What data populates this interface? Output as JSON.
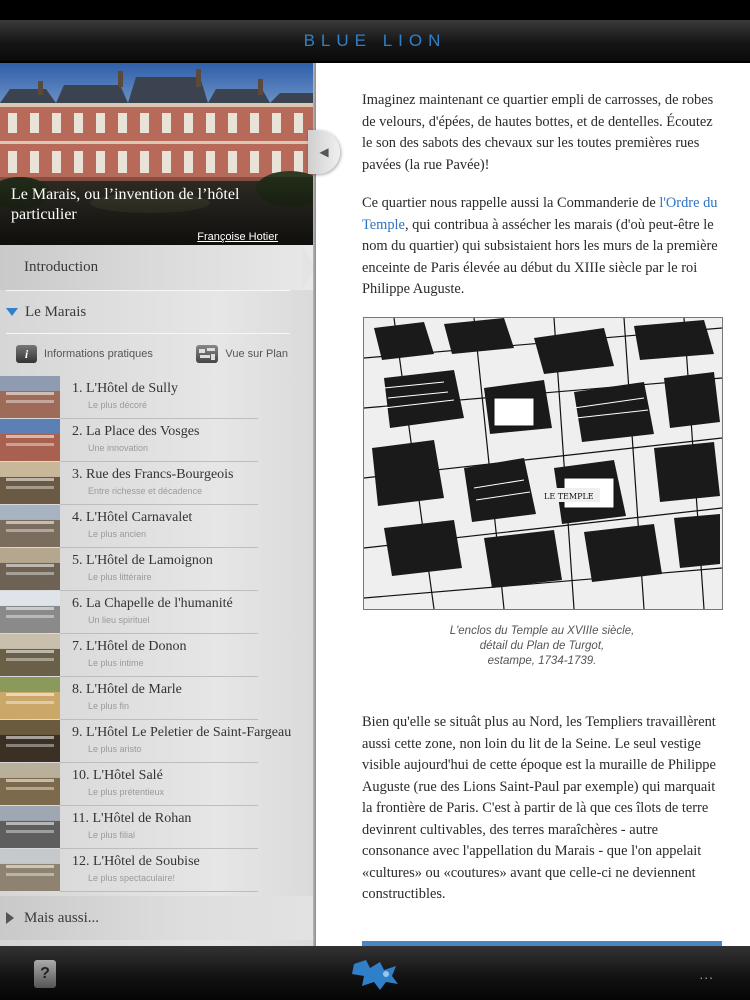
{
  "app": {
    "title": "BLUE LION"
  },
  "hero": {
    "title": "Le Marais, ou l’invention de l’hôtel particulier",
    "author": "Françoise Hotier"
  },
  "sidebar": {
    "introduction": "Introduction",
    "section": "Le Marais",
    "info_label": "Informations pratiques",
    "map_label": "Vue sur Plan",
    "chapters": [
      {
        "title": "1. L'Hôtel de Sully",
        "subtitle": "Le plus décoré"
      },
      {
        "title": "2. La Place des Vosges",
        "subtitle": "Une innovation"
      },
      {
        "title": "3. Rue des Francs-Bourgeois",
        "subtitle": "Entre richesse et décadence"
      },
      {
        "title": "4. L'Hôtel Carnavalet",
        "subtitle": "Le plus ancien"
      },
      {
        "title": "5. L'Hôtel de Lamoignon",
        "subtitle": "Le plus littéraire"
      },
      {
        "title": "6. La Chapelle de l'humanité",
        "subtitle": "Un lieu spirituel"
      },
      {
        "title": "7. L'Hôtel de Donon",
        "subtitle": "Le plus intime"
      },
      {
        "title": "8. L'Hôtel de Marle",
        "subtitle": "Le plus fin"
      },
      {
        "title": "9. L'Hôtel Le Peletier de Saint-Fargeau",
        "subtitle": "Le plus aristo"
      },
      {
        "title": "10. L'Hôtel Salé",
        "subtitle": "Le plus prétentieux"
      },
      {
        "title": "11. L'Hôtel de Rohan",
        "subtitle": "Le plus filial"
      },
      {
        "title": "12. L'Hôtel de Soubise",
        "subtitle": "Le plus spectaculaire!"
      }
    ],
    "more": "Mais aussi..."
  },
  "content": {
    "p1": "Imaginez maintenant ce quartier empli de carrosses, de robes de velours, d'épées, de hautes bottes, et de dentelles. Écoutez le son des sabots des chevaux sur les toutes premières rues pavées (la rue Pavée)!",
    "p2_before": "Ce quartier nous rappelle aussi la Commanderie de ",
    "p2_link": "l'Ordre du Temple",
    "p2_after": ", qui contribua à assécher les marais (d'où peut-être le nom du quartier) qui subsistaient hors les murs de la première enceinte de Paris élevée au début du XIIIe siècle par le roi Philippe Auguste.",
    "figure_label": "LE TEMPLE",
    "caption_l1": "L'enclos du Temple au XVIIIe siècle,",
    "caption_l2": "détail du Plan de Turgot,",
    "caption_l3": "estampe, 1734-1739.",
    "p3": "Bien qu'elle se situât plus au Nord, les Templiers travaillèrent aussi cette zone, non loin du lit de la Seine. Le seul vestige visible aujourd'hui de cette époque est la muraille de Philippe Auguste (rue des Lions Saint-Paul par exemple) qui marquait la frontière de Paris. C'est à partir de là que ces îlots de terre devinrent cultivables, des terres maraîchères - autre consonance avec l'appellation du Marais - que l'on appelait «cultures» ou «coutures» avant que celle-ci ne deviennent constructibles."
  },
  "bottombar": {
    "bookmark_glyph": "?",
    "more": "..."
  },
  "colors": {
    "accent": "#2f80c8",
    "link": "#2f72c2"
  }
}
